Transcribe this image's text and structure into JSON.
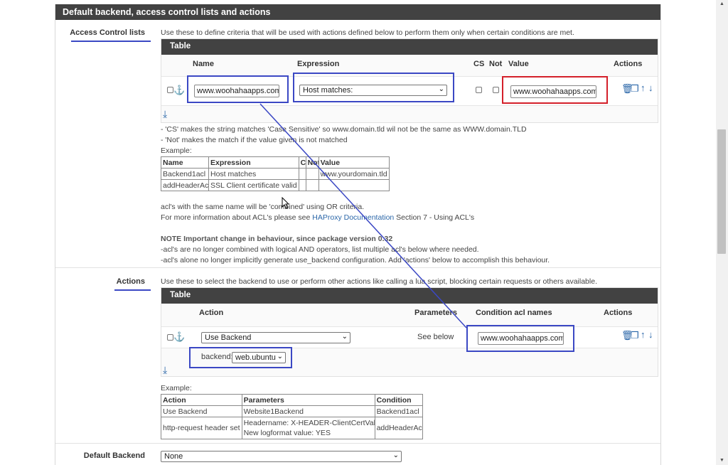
{
  "panel": {
    "title": "Default backend, access control lists and actions"
  },
  "acl": {
    "label": "Access Control lists",
    "intro": "Use these to define criteria that will be used with actions defined below to perform them only when certain conditions are met.",
    "table_title": "Table",
    "columns": {
      "name": "Name",
      "expression": "Expression",
      "cs": "CS",
      "not": "Not",
      "value": "Value",
      "actions": "Actions"
    },
    "row": {
      "name": "www.woohahaapps.com",
      "expression": "Host matches:",
      "value": "www.woohahaapps.com"
    },
    "help": [
      "- 'CS' makes the string matches 'Case Sensitive' so www.domain.tld wil not be the same as WWW.domain.TLD",
      "- 'Not' makes the match if the value given is not matched",
      "Example:"
    ],
    "example": {
      "headers": [
        "Name",
        "Expression",
        "CS",
        "Not",
        "Value"
      ],
      "rows": [
        [
          "Backend1acl",
          "Host matches",
          "",
          "",
          "www.yourdomain.tld"
        ],
        [
          "addHeaderAcl",
          "SSL Client certificate valid",
          "",
          "",
          ""
        ]
      ]
    },
    "notes": {
      "combined": "acl's with the same name will be 'combined' using OR criteria.",
      "more_info_prefix": "For more information about ACL's please see ",
      "more_info_link": "HAProxy Documentation",
      "more_info_suffix": " Section 7 - Using ACL's",
      "important": "NOTE Important change in behaviour, since package version 0.32",
      "line1": "-acl's are no longer combined with logical AND operators, list multiple acl's below where needed.",
      "line2": "-acl's alone no longer implicitly generate use_backend configuration. Add 'actions' below to accomplish this behaviour."
    }
  },
  "actions": {
    "label": "Actions",
    "intro": "Use these to select the backend to use or perform other actions like calling a lua script, blocking certain requests or others available.",
    "table_title": "Table",
    "columns": {
      "action": "Action",
      "parameters": "Parameters",
      "condition": "Condition acl names",
      "actions": "Actions"
    },
    "row": {
      "action": "Use Backend",
      "parameters": "See below",
      "condition": "www.woohahaapps.com",
      "backend_label": "backend:",
      "backend_value": "web.ubuntu"
    },
    "example_label": "Example:",
    "example": {
      "headers": [
        "Action",
        "Parameters",
        "Condition"
      ],
      "rows": [
        [
          "Use Backend",
          "Website1Backend",
          "Backend1acl"
        ],
        [
          "http-request header set",
          "Headername: X-HEADER-ClientCertValid",
          "addHeaderAcl"
        ]
      ],
      "extra_param_line": "New logformat value: YES"
    }
  },
  "default_backend": {
    "label": "Default Backend",
    "value": "None"
  },
  "colors": {
    "header_bg": "#424242",
    "highlight_blue": "#3b48c4",
    "highlight_red": "#d4202a",
    "link": "#2a66a8"
  },
  "icons": [
    "anchor-icon",
    "trash-icon",
    "copy-icon",
    "arrow-up-icon",
    "arrow-down-icon",
    "add-row-icon",
    "mouse-cursor-icon"
  ]
}
